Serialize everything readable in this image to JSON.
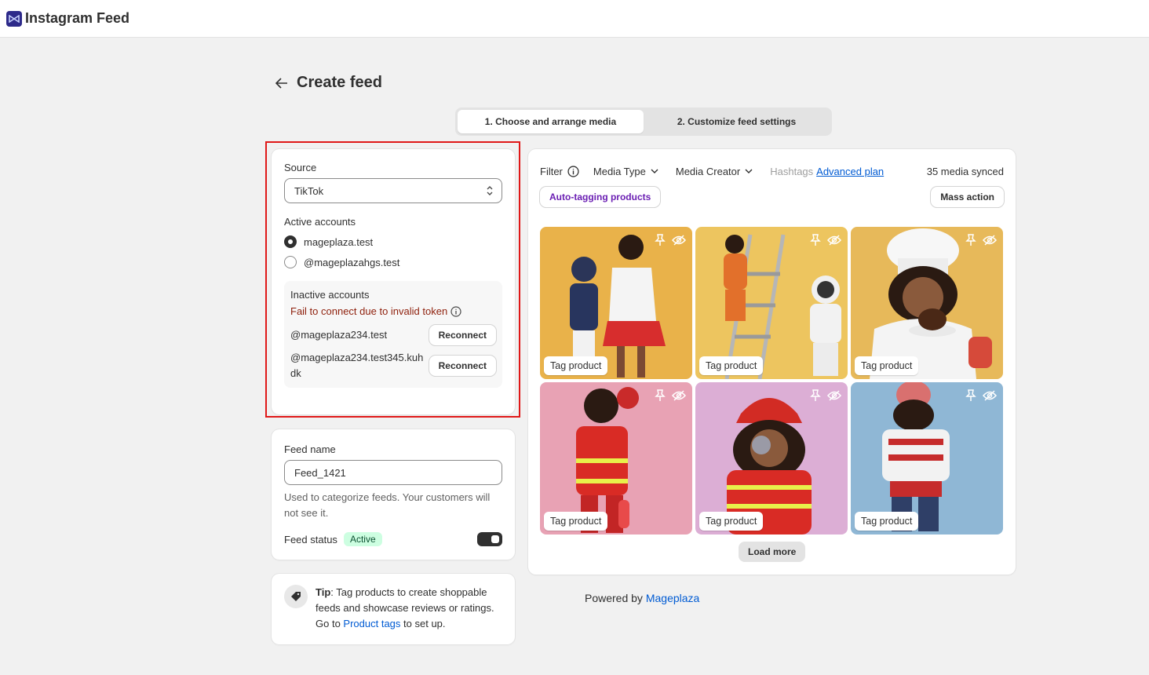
{
  "app": {
    "title": "Instagram Feed"
  },
  "page": {
    "title": "Create feed"
  },
  "steps": [
    {
      "label": "1. Choose and arrange media"
    },
    {
      "label": "2. Customize feed settings"
    }
  ],
  "source": {
    "label": "Source",
    "selected": "TikTok",
    "active_label": "Active accounts",
    "active_accounts": [
      {
        "name": "mageplaza.test"
      },
      {
        "name": "@mageplazahgs.test"
      }
    ],
    "inactive_label": "Inactive accounts",
    "inactive_error": "Fail to connect due to invalid token",
    "inactive_accounts": [
      {
        "name": "@mageplaza234.test",
        "action": "Reconnect"
      },
      {
        "name": "@mageplaza234.test345.kuhdk",
        "action": "Reconnect"
      }
    ]
  },
  "feed": {
    "name_label": "Feed name",
    "name_value": "Feed_1421",
    "help": "Used to categorize feeds. Your customers will not see it.",
    "status_label": "Feed status",
    "status_badge": "Active"
  },
  "tip": {
    "bold": "Tip",
    "text": ": Tag products to create shoppable feeds and showcase reviews or ratings. Go to ",
    "link": "Product tags",
    "tail": " to set up."
  },
  "filters": {
    "filter_label": "Filter",
    "media_type": "Media Type",
    "media_creator": "Media Creator",
    "hashtags": "Hashtags",
    "advanced_plan": "Advanced plan",
    "synced": "35 media synced",
    "auto_tagging": "Auto-tagging products",
    "mass_action": "Mass action"
  },
  "media": [
    {
      "tag": "Tag product",
      "bg": "#e9b24a"
    },
    {
      "tag": "Tag product",
      "bg": "#edc55f"
    },
    {
      "tag": "Tag product",
      "bg": "#e7b95a"
    },
    {
      "tag": "Tag product",
      "bg": "#e8a2b4"
    },
    {
      "tag": "Tag product",
      "bg": "#dcaed5"
    },
    {
      "tag": "Tag product",
      "bg": "#8fb7d5"
    }
  ],
  "load_more": "Load more",
  "footer": {
    "prefix": "Powered by ",
    "link": "Mageplaza"
  }
}
